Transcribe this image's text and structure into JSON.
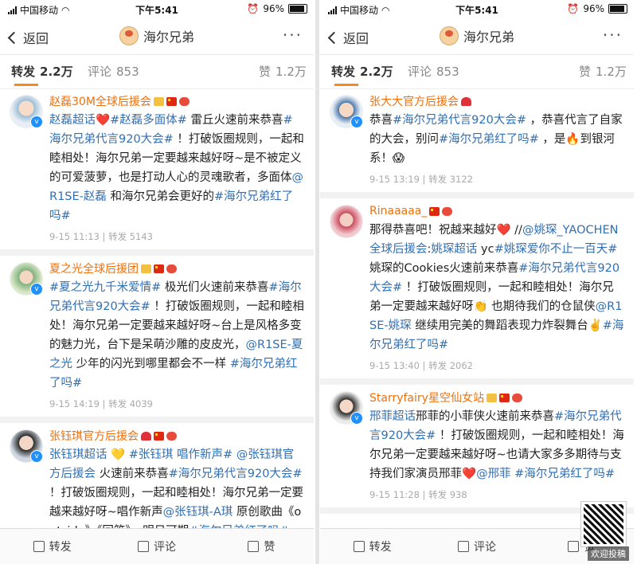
{
  "status": {
    "carrier": "中国移动",
    "time": "下午5:41",
    "battery": "96%"
  },
  "nav": {
    "back": "返回",
    "title": "海尔兄弟",
    "more": "···"
  },
  "tabs": {
    "repost": "转发",
    "repost_count": "2.2万",
    "comment": "评论",
    "comment_count": "853",
    "like": "赞",
    "like_count": "1.2万"
  },
  "left_posts": [
    {
      "name": "赵磊30M全球后援会",
      "segments": [
        {
          "t": "赵磊超话",
          "l": true
        },
        {
          "t": "❤️"
        },
        {
          "t": "#赵磊多面体#",
          "l": true
        },
        {
          "t": " 雷丘火速前来恭喜"
        },
        {
          "t": "#海尔兄弟代言920大会#",
          "l": true
        },
        {
          "t": " ！打破饭圈规则，一起和睦相处！海尔兄弟一定要越来越好呀~是不被定义的可爱菠萝，也是打动人心的灵魂歌者，多面体"
        },
        {
          "t": "@R1SE-赵磊",
          "l": true
        },
        {
          "t": " 和海尔兄弟会更好的"
        },
        {
          "t": "#海尔兄弟红了吗#",
          "l": true
        }
      ],
      "meta": "9-15 11:13 | 转发 5143"
    },
    {
      "name": "夏之光全球后援团",
      "segments": [
        {
          "t": "#夏之光九千米爱情#",
          "l": true
        },
        {
          "t": " 极光们火速前来恭喜"
        },
        {
          "t": "#海尔兄弟代言920大会#",
          "l": true
        },
        {
          "t": " ！打破饭圈规则，一起和睦相处！海尔兄弟一定要越来越好呀~台上是风格多变的魅力光，台下是呆萌沙雕的皮皮光，"
        },
        {
          "t": "@R1SE-夏之光",
          "l": true
        },
        {
          "t": " 少年的闪光到哪里都会不一样 "
        },
        {
          "t": "#海尔兄弟红了吗#",
          "l": true
        }
      ],
      "meta": "9-15 14:19 | 转发 4039"
    },
    {
      "name": "张钰琪官方后援会",
      "segments": [
        {
          "t": "张钰琪超话",
          "l": true
        },
        {
          "t": " 💛 "
        },
        {
          "t": "#张钰琪 唱作新声#",
          "l": true
        },
        {
          "t": " "
        },
        {
          "t": "@张钰琪官方后援会",
          "l": true
        },
        {
          "t": " 火速前来恭喜"
        },
        {
          "t": "#海尔兄弟代言920大会#",
          "l": true
        },
        {
          "t": " ！打破饭圈规则，一起和睦相处！海尔兄弟一定要越来越好呀~唱作新声"
        },
        {
          "t": "@张钰琪-A琪",
          "l": true
        },
        {
          "t": " 原创歌曲《outside》《回答》，明日可期"
        },
        {
          "t": "#海尔兄弟红了吗#",
          "l": true
        }
      ],
      "meta": ""
    }
  ],
  "right_posts": [
    {
      "name": "张大大官方后援会",
      "segments": [
        {
          "t": "恭喜"
        },
        {
          "t": "#海尔兄弟代言920大会#",
          "l": true
        },
        {
          "t": " ，恭喜代言了自家的大会，别问"
        },
        {
          "t": "#海尔兄弟红了吗#",
          "l": true
        },
        {
          "t": " ，是🔥到银河系！😱"
        }
      ],
      "meta": "9-15 13:19 | 转发 3122"
    },
    {
      "name": "Rinaaaaa_",
      "segments": [
        {
          "t": "那得恭喜吧！祝越来越好❤️ //"
        },
        {
          "t": "@姚琛_YAOCHEN全球后援会",
          "l": true
        },
        {
          "t": ":"
        },
        {
          "t": "姚琛超话",
          "l": true
        },
        {
          "t": " yc"
        },
        {
          "t": "#姚琛爱你不止一百天#",
          "l": true
        },
        {
          "t": " 姚琛的Cookies火速前来恭喜"
        },
        {
          "t": "#海尔兄弟代言920大会#",
          "l": true
        },
        {
          "t": " ！打破饭圈规则，一起和睦相处！海尔兄弟一定要越来越好呀👏 也期待我们的仓鼠侠"
        },
        {
          "t": "@R1SE-姚琛",
          "l": true
        },
        {
          "t": " 继续用完美的舞蹈表现力炸裂舞台✌️"
        },
        {
          "t": "#海尔兄弟红了吗#",
          "l": true
        }
      ],
      "meta": "9-15 13:40 | 转发 2062"
    },
    {
      "name": "Starryfairy星空仙女站",
      "segments": [
        {
          "t": "邢菲超话",
          "l": true
        },
        {
          "t": "邢菲的小菲侠火速前来恭喜"
        },
        {
          "t": "#海尔兄弟代言920大会#",
          "l": true
        },
        {
          "t": " ！打破饭圈规则，一起和睦相处！海尔兄弟一定要越来越好呀~也请大家多多期待与支持我们家演员邢菲❤️"
        },
        {
          "t": "@邢菲",
          "l": true
        },
        {
          "t": " "
        },
        {
          "t": "#海尔兄弟红了吗#",
          "l": true
        }
      ],
      "meta": "9-15 11:28 | 转发 938"
    }
  ],
  "bottom": {
    "repost": "转发",
    "comment": "评论",
    "like": "赞"
  },
  "watermark": "欢迎投稿",
  "colors": {
    "accent": "#f88a1f",
    "link": "#2f6fb5",
    "username": "#f0700c"
  }
}
